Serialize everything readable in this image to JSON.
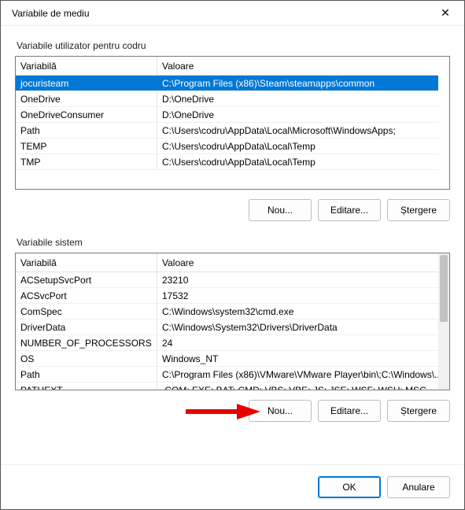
{
  "window": {
    "title": "Variabile de mediu",
    "close": "✕"
  },
  "user_section": {
    "label": "Variabile utilizator pentru codru",
    "col_variable": "Variabilă",
    "col_value": "Valoare",
    "rows": [
      {
        "name": "jocuristeam",
        "value": "C:\\Program Files (x86)\\Steam\\steamapps\\common",
        "selected": true
      },
      {
        "name": "OneDrive",
        "value": "D:\\OneDrive"
      },
      {
        "name": "OneDriveConsumer",
        "value": "D:\\OneDrive"
      },
      {
        "name": "Path",
        "value": "C:\\Users\\codru\\AppData\\Local\\Microsoft\\WindowsApps;"
      },
      {
        "name": "TEMP",
        "value": "C:\\Users\\codru\\AppData\\Local\\Temp"
      },
      {
        "name": "TMP",
        "value": "C:\\Users\\codru\\AppData\\Local\\Temp"
      }
    ],
    "btn_new": "Nou...",
    "btn_edit": "Editare...",
    "btn_delete": "Ștergere"
  },
  "system_section": {
    "label": "Variabile sistem",
    "col_variable": "Variabilă",
    "col_value": "Valoare",
    "rows": [
      {
        "name": "ACSetupSvcPort",
        "value": "23210"
      },
      {
        "name": "ACSvcPort",
        "value": "17532"
      },
      {
        "name": "ComSpec",
        "value": "C:\\Windows\\system32\\cmd.exe"
      },
      {
        "name": "DriverData",
        "value": "C:\\Windows\\System32\\Drivers\\DriverData"
      },
      {
        "name": "NUMBER_OF_PROCESSORS",
        "value": "24"
      },
      {
        "name": "OS",
        "value": "Windows_NT"
      },
      {
        "name": "Path",
        "value": "C:\\Program Files (x86)\\VMware\\VMware Player\\bin\\;C:\\Windows\\..."
      },
      {
        "name": "PATHEXT",
        "value": ".COM;.EXE;.BAT;.CMD;.VBS;.VBE;.JS;.JSE;.WSF;.WSH;.MSC"
      }
    ],
    "btn_new": "Nou...",
    "btn_edit": "Editare...",
    "btn_delete": "Ștergere"
  },
  "footer": {
    "ok": "OK",
    "cancel": "Anulare"
  },
  "annotation": {
    "arrow_color": "#e60000"
  }
}
